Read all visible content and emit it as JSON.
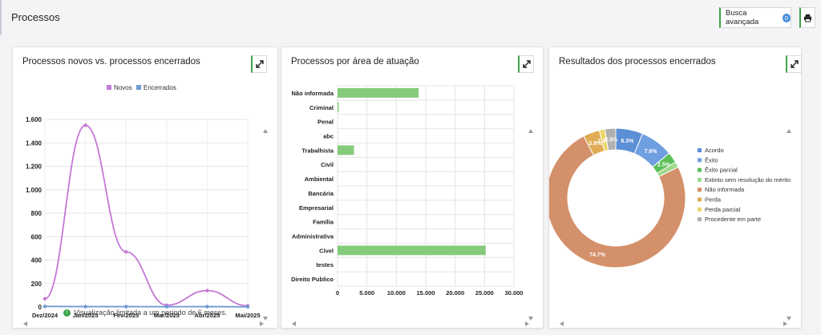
{
  "page": {
    "title": "Processos"
  },
  "toolbar": {
    "search_label": "Busca avançada",
    "search_count": "0",
    "print_icon": "printer-icon"
  },
  "cards": {
    "novos": {
      "title": "Processos novos vs. processos encerrados",
      "note": "Visualização limitada a um período de 6 meses."
    },
    "area": {
      "title": "Processos por área de atuação"
    },
    "resultados": {
      "title": "Resultados dos processos encerrados"
    }
  },
  "colors": {
    "novos": "#c478d6",
    "encerrados": "#6f9ad4",
    "bar": "#86cb7c",
    "accent": "#3ca34a"
  },
  "chart_data": [
    {
      "type": "line",
      "categories": [
        "Dez/2024",
        "Jan/2025",
        "Fev/2025",
        "Mar/2025",
        "Abr/2025",
        "Mai/2025"
      ],
      "series": [
        {
          "name": "Novos",
          "values": [
            70,
            1550,
            470,
            15,
            140,
            10
          ]
        },
        {
          "name": "Encerrados",
          "values": [
            5,
            3,
            3,
            2,
            3,
            1
          ]
        }
      ],
      "ylim": [
        0,
        1600
      ],
      "yticks": [
        "0",
        "200",
        "400",
        "600",
        "800",
        "1.000",
        "1.200",
        "1.400",
        "1.600"
      ],
      "legend": "top"
    },
    {
      "type": "bar",
      "orientation": "horizontal",
      "categories": [
        "Não informada",
        "Criminal",
        "Penal",
        "abc",
        "Trabalhista",
        "Civil",
        "Ambiental",
        "Bancária",
        "Empresarial",
        "Família",
        "Administrativa",
        "Cível",
        "testes",
        "Direito Publico"
      ],
      "values": [
        13800,
        100,
        0,
        0,
        2800,
        0,
        0,
        0,
        0,
        0,
        0,
        25200,
        0,
        0
      ],
      "xlim": [
        0,
        30000
      ],
      "xticks": [
        "0",
        "5.000",
        "10.000",
        "15.000",
        "20.000",
        "25.000",
        "30.000"
      ]
    },
    {
      "type": "pie",
      "donut": true,
      "labels": [
        "Acordo",
        "Êxito",
        "Êxito parcial",
        "Extinto sem resolução do mérito",
        "Não informada",
        "Perda",
        "Perda parcial",
        "Procedente em parte"
      ],
      "values": [
        6.3,
        7.6,
        2.5,
        1.3,
        74.7,
        3.8,
        1.3,
        2.5
      ],
      "value_labels": [
        "6.3%",
        "7.6%",
        "2.5%",
        "",
        "74.7%",
        "3.8%",
        "1.3%",
        "2.5%"
      ],
      "colors": [
        "#5b8fd6",
        "#6f9fe0",
        "#5cbf58",
        "#9fd88c",
        "#d4906a",
        "#e0ac55",
        "#ecd46a",
        "#b0b0b0"
      ],
      "legend": "right"
    }
  ]
}
